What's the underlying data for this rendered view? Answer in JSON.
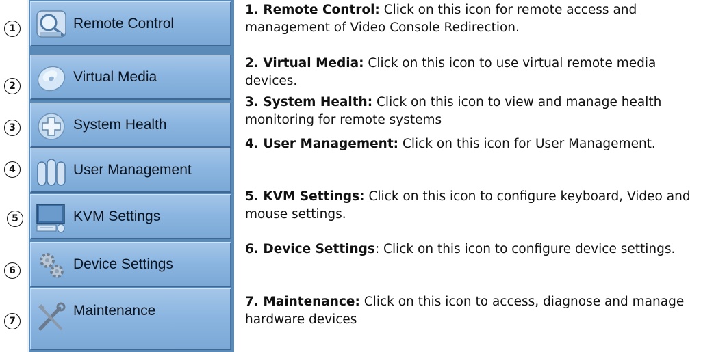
{
  "menu": {
    "items": [
      {
        "number": "1",
        "label": "Remote Control",
        "icon": "remote-control-icon"
      },
      {
        "number": "2",
        "label": "Virtual Media",
        "icon": "virtual-media-disc-icon"
      },
      {
        "number": "3",
        "label": "System Health",
        "icon": "system-health-cross-icon"
      },
      {
        "number": "4",
        "label": "User Management",
        "icon": "user-management-users-icon"
      },
      {
        "number": "5",
        "label": "KVM Settings",
        "icon": "kvm-settings-monitor-icon"
      },
      {
        "number": "6",
        "label": "Device Settings",
        "icon": "device-settings-gears-icon"
      },
      {
        "number": "7",
        "label": "Maintenance",
        "icon": "maintenance-tools-icon"
      }
    ]
  },
  "descriptions": [
    {
      "title": "1. Remote Control:",
      "text": " Click on this icon for remote access and management of Video Console Redirection."
    },
    {
      "title": "2. Virtual Media:",
      "text": " Click on this icon to use virtual remote media devices."
    },
    {
      "title": "3. System Health:",
      "text": " Click on this icon to view and manage health monitoring for remote systems"
    },
    {
      "title": "4. User Management:",
      "text": " Click on this icon for User Management."
    },
    {
      "title": "5. KVM Settings:",
      "text": " Click on this icon to configure keyboard, Video and mouse settings."
    },
    {
      "title": "6. Device Settings",
      "text": ": Click on this icon to configure device settings."
    },
    {
      "title": "7. Maintenance:",
      "text": " Click on this icon to access, diagnose and manage hardware devices"
    }
  ],
  "colors": {
    "button_face": "#8cb6e1",
    "panel": "#5a8ab8",
    "text": "#111111"
  }
}
